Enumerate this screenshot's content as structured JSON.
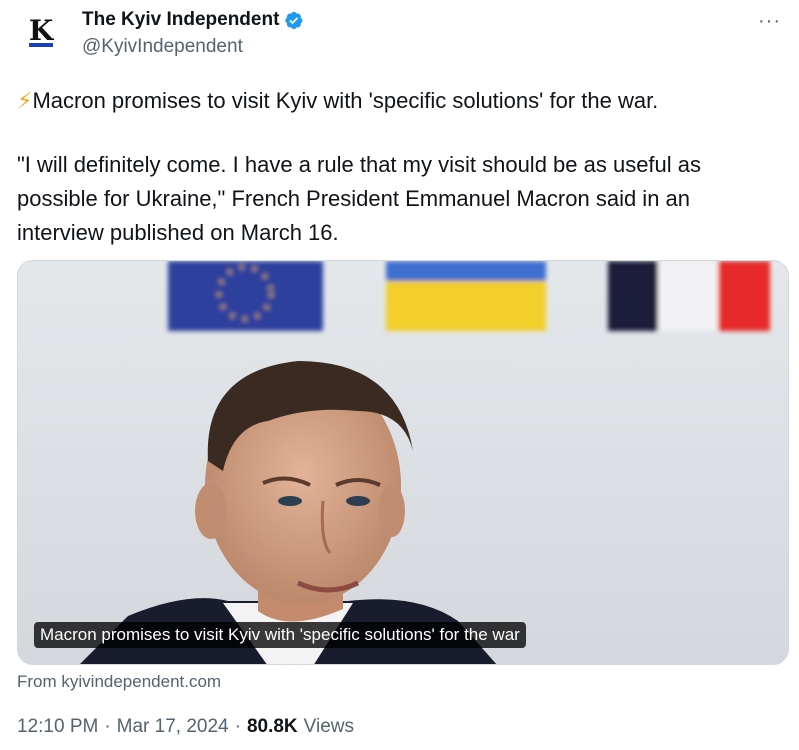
{
  "author": {
    "display_name": "The Kyiv Independent",
    "handle": "@KyivIndependent",
    "avatar_letter": "K",
    "verified": true
  },
  "more_menu": "···",
  "tweet": {
    "emoji": "⚡",
    "line1": "Macron promises to visit Kyiv with 'specific solutions' for the war.",
    "line2": "\"I will definitely come. I have a rule that my visit should be as useful as possible for Ukraine,\" French President Emmanuel Macron said in an interview published on March 16."
  },
  "card": {
    "caption": "Macron promises to visit Kyiv with 'specific solutions' for the war",
    "source": "From kyivindependent.com"
  },
  "meta": {
    "time": "12:10 PM",
    "dot1": "·",
    "date": "Mar 17, 2024",
    "dot2": "·",
    "views_count": "80.8K",
    "views_label": "Views"
  },
  "colors": {
    "verified_blue": "#1d9bf0",
    "text_secondary": "#536471",
    "eu_blue": "#2f3f9e",
    "ukraine_blue": "#3c6fd1",
    "ukraine_yellow": "#f2cf2a",
    "france_blue": "#1f1f3a",
    "france_red": "#e62b2b"
  },
  "icons": {
    "verified": "verified-badge-icon",
    "more": "more-horizontal-icon"
  }
}
